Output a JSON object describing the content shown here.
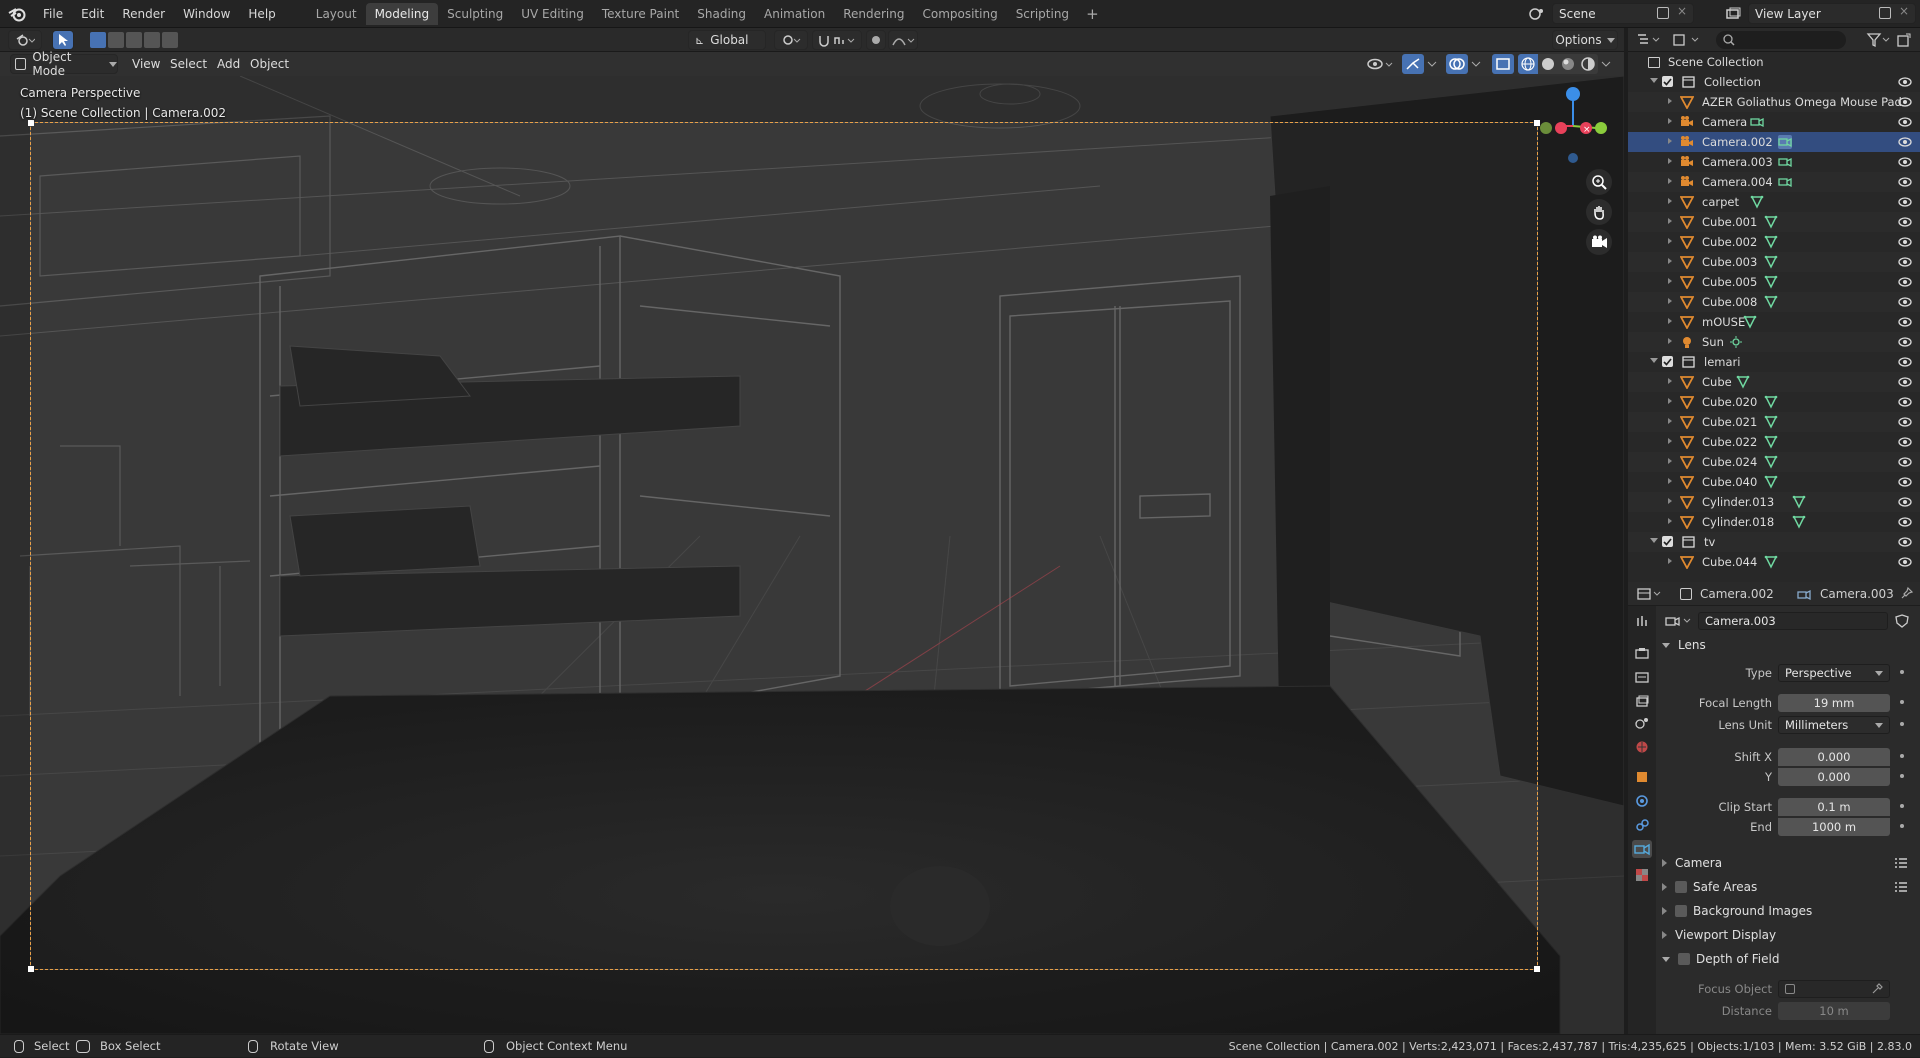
{
  "menu": [
    "File",
    "Edit",
    "Render",
    "Window",
    "Help"
  ],
  "workspaces": [
    "Layout",
    "Modeling",
    "Sculpting",
    "UV Editing",
    "Texture Paint",
    "Shading",
    "Animation",
    "Rendering",
    "Compositing",
    "Scripting"
  ],
  "active_workspace": "Modeling",
  "scene": {
    "name": "Scene",
    "view_layer": "View Layer"
  },
  "toolbar": {
    "transform_orientation": "Global",
    "options_label": "Options"
  },
  "viewport_header": {
    "mode": "Object Mode",
    "menus": [
      "View",
      "Select",
      "Add",
      "Object"
    ]
  },
  "viewport": {
    "title": "Camera Perspective",
    "subtitle": "(1) Scene Collection | Camera.002"
  },
  "outliner": {
    "root": "Scene Collection",
    "rows": [
      {
        "label": "Collection",
        "kind": "collection"
      },
      {
        "label": "AZER Goliathus Omega Mouse Pad",
        "kind": "mesh"
      },
      {
        "label": "Camera",
        "kind": "camera"
      },
      {
        "label": "Camera.002",
        "kind": "camera",
        "selected": true
      },
      {
        "label": "Camera.003",
        "kind": "camera"
      },
      {
        "label": "Camera.004",
        "kind": "camera"
      },
      {
        "label": "carpet",
        "kind": "mesh"
      },
      {
        "label": "Cube.001",
        "kind": "mesh"
      },
      {
        "label": "Cube.002",
        "kind": "mesh"
      },
      {
        "label": "Cube.003",
        "kind": "mesh"
      },
      {
        "label": "Cube.005",
        "kind": "mesh"
      },
      {
        "label": "Cube.008",
        "kind": "mesh"
      },
      {
        "label": "mOUSE",
        "kind": "mesh"
      },
      {
        "label": "Sun",
        "kind": "light"
      },
      {
        "label": "lemari",
        "kind": "collection"
      },
      {
        "label": "Cube",
        "kind": "mesh"
      },
      {
        "label": "Cube.020",
        "kind": "mesh"
      },
      {
        "label": "Cube.021",
        "kind": "mesh"
      },
      {
        "label": "Cube.022",
        "kind": "mesh"
      },
      {
        "label": "Cube.024",
        "kind": "mesh"
      },
      {
        "label": "Cube.040",
        "kind": "mesh"
      },
      {
        "label": "Cylinder.013",
        "kind": "mesh"
      },
      {
        "label": "Cylinder.018",
        "kind": "mesh"
      },
      {
        "label": "tv",
        "kind": "collection"
      },
      {
        "label": "Cube.044",
        "kind": "mesh"
      }
    ]
  },
  "properties": {
    "breadcrumb_object": "Camera.002",
    "breadcrumb_data": "Camera.003",
    "datablock": "Camera.003",
    "lens_panel": "Lens",
    "type_label": "Type",
    "type_value": "Perspective",
    "focal_label": "Focal Length",
    "focal_value": "19 mm",
    "lens_unit_label": "Lens Unit",
    "lens_unit_value": "Millimeters",
    "shift_x_label": "Shift X",
    "shift_x_value": "0.000",
    "shift_y_label": "Y",
    "shift_y_value": "0.000",
    "clip_start_label": "Clip Start",
    "clip_start_value": "0.1 m",
    "clip_end_label": "End",
    "clip_end_value": "1000 m",
    "panels": [
      "Camera",
      "Safe Areas",
      "Background Images",
      "Viewport Display",
      "Depth of Field"
    ],
    "focus_object_label": "Focus Object",
    "distance_label": "Distance",
    "distance_value": "10 m"
  },
  "status": {
    "select": "Select",
    "box_select": "Box Select",
    "rotate": "Rotate View",
    "context": "Object Context Menu",
    "stats": "Scene Collection | Camera.002 | Verts:2,423,071 | Faces:2,437,787 | Tris:4,235,625 | Objects:1/103 | Mem: 3.52 GiB | 2.83.0"
  },
  "colors": {
    "accent": "#334d80",
    "camera_frame": "#e8a048",
    "header_bg": "#242424",
    "axis_x": "#e8415a",
    "axis_y": "#8bcc3c",
    "axis_z": "#3b8ee8"
  }
}
